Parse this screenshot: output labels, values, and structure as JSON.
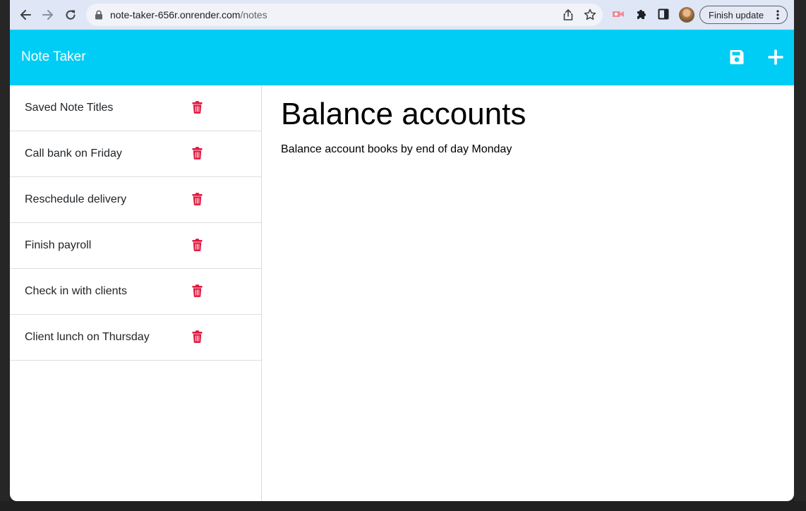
{
  "browser": {
    "url_host": "note-taker-656r.onrender.com",
    "url_path": "/notes",
    "finish_update_label": "Finish update"
  },
  "app": {
    "brand": "Note Taker",
    "accent_color": "#00cdf5",
    "delete_color": "#e0173d"
  },
  "notes": [
    {
      "title": "Saved Note Titles"
    },
    {
      "title": "Call bank on Friday"
    },
    {
      "title": "Reschedule delivery"
    },
    {
      "title": "Finish payroll"
    },
    {
      "title": "Check in with clients"
    },
    {
      "title": "Client lunch on Thursday"
    }
  ],
  "active_note": {
    "title": "Balance accounts",
    "text": "Balance account books by end of day Monday"
  }
}
